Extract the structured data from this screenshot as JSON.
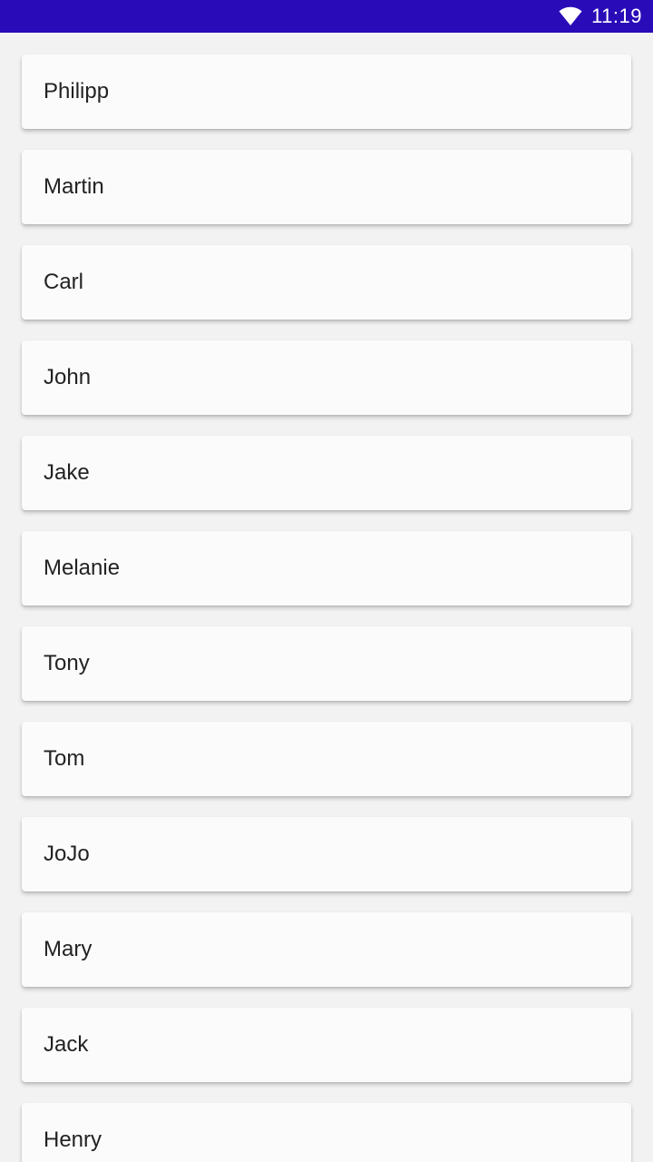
{
  "status_bar": {
    "time": "11:19",
    "icons": [
      "wifi-icon"
    ],
    "background_color": "#2a0bb8"
  },
  "list": {
    "items": [
      {
        "label": "Philipp"
      },
      {
        "label": "Martin"
      },
      {
        "label": "Carl"
      },
      {
        "label": "John"
      },
      {
        "label": "Jake"
      },
      {
        "label": "Melanie"
      },
      {
        "label": "Tony"
      },
      {
        "label": "Tom"
      },
      {
        "label": "JoJo"
      },
      {
        "label": "Mary"
      },
      {
        "label": "Jack"
      },
      {
        "label": "Henry"
      }
    ]
  }
}
